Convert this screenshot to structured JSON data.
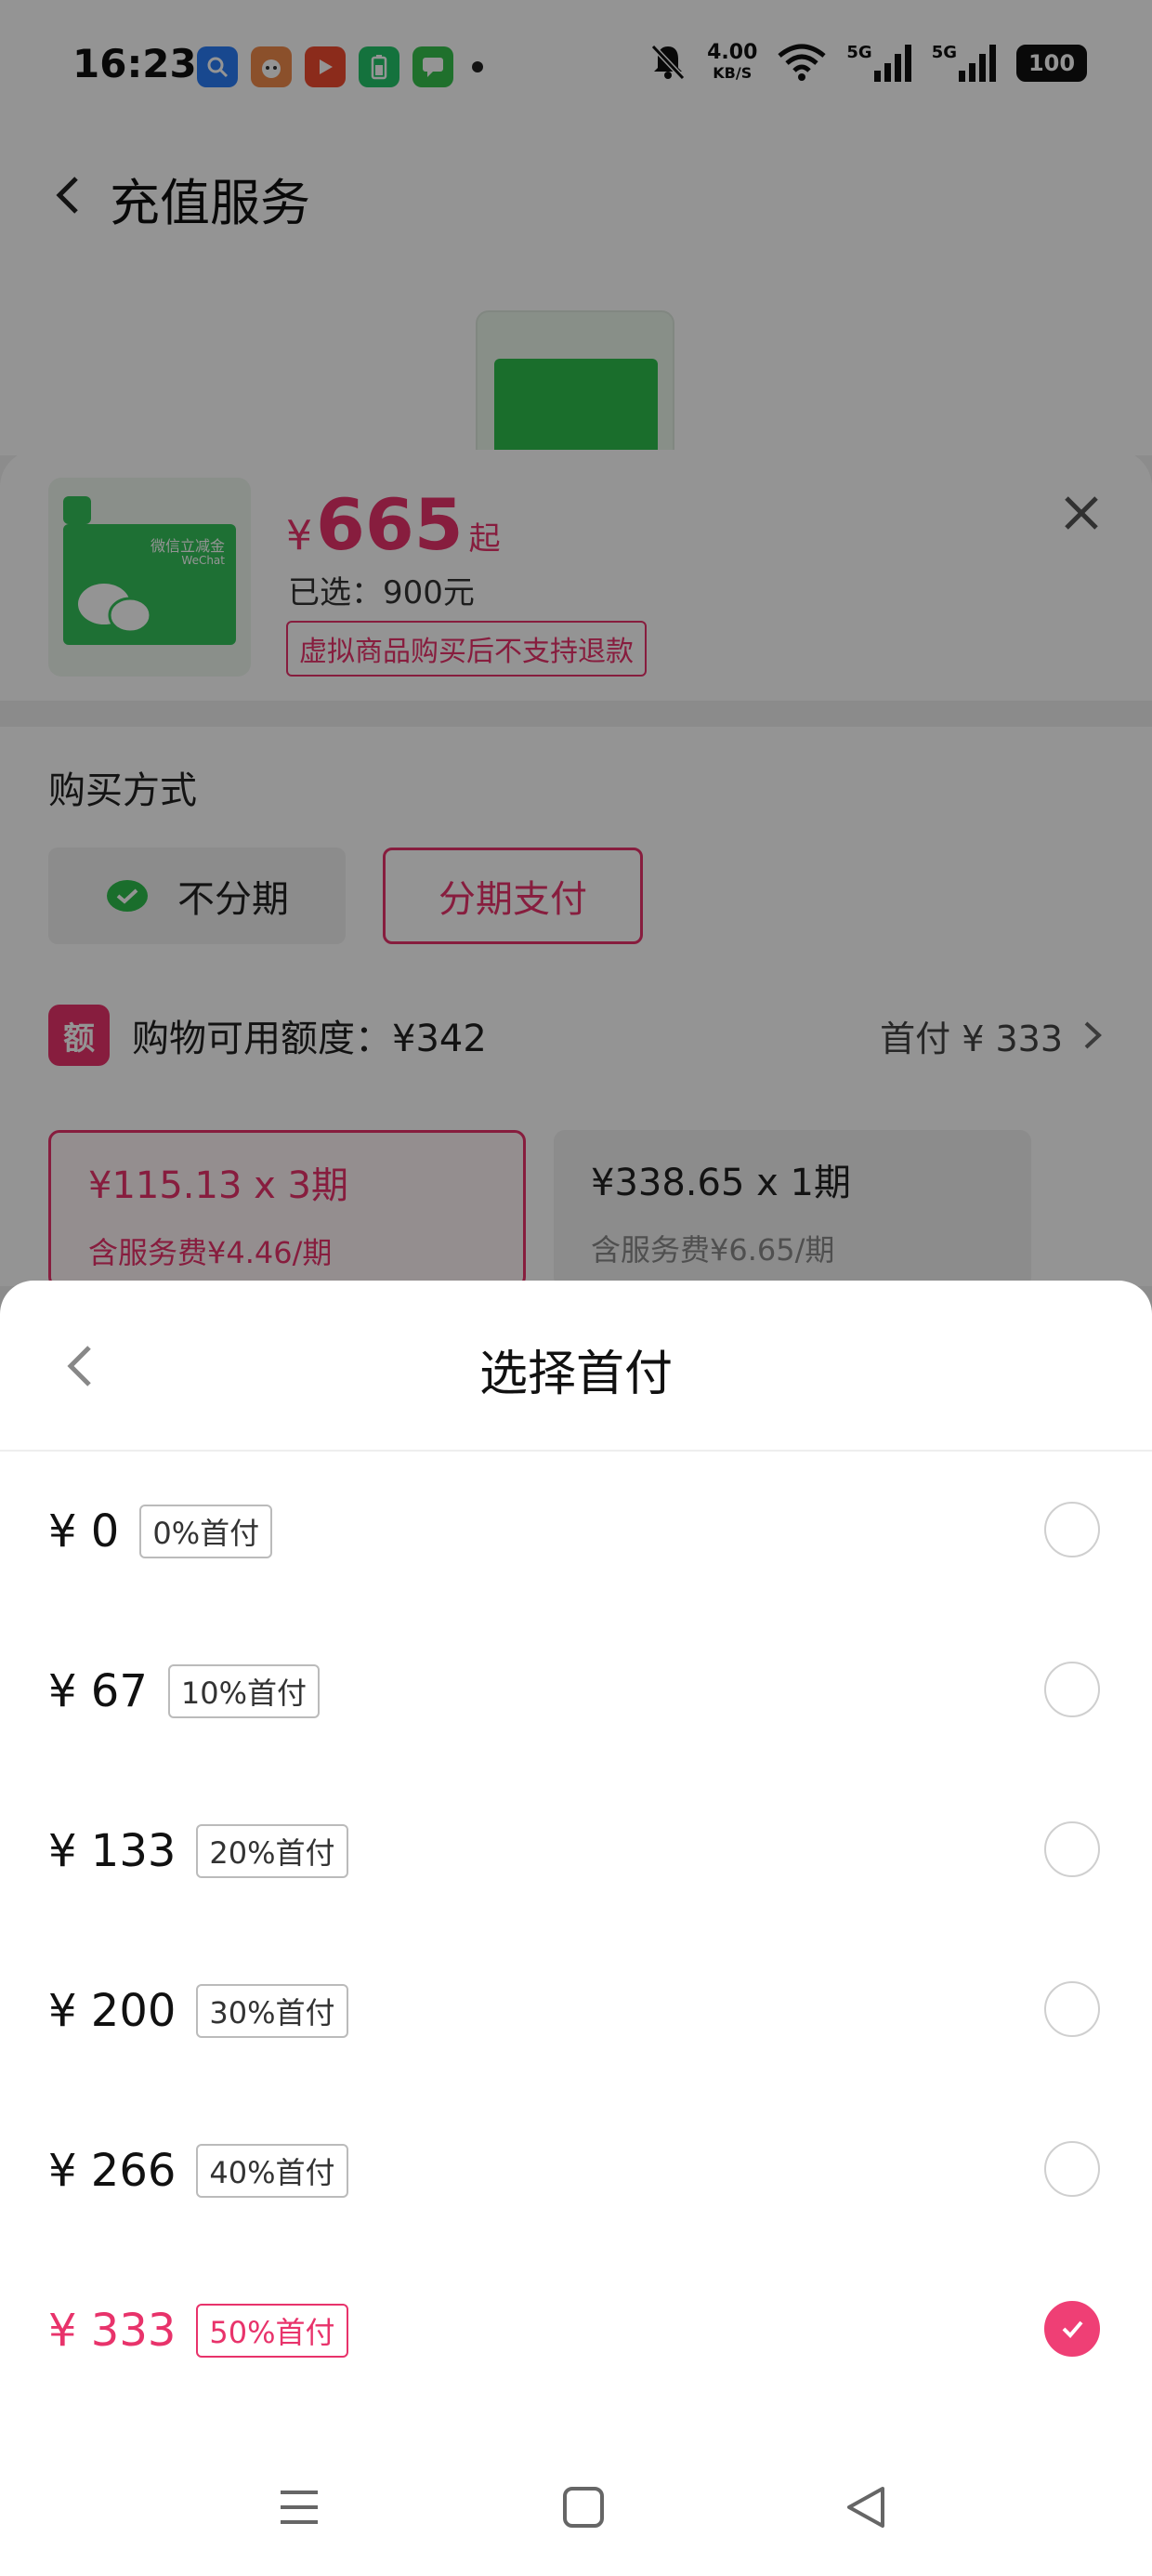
{
  "status_bar": {
    "time": "16:23",
    "net_speed_value": "4.00",
    "net_speed_unit": "KB/S",
    "signal_label_1": "5G",
    "signal_label_2": "5G",
    "battery": "100",
    "app_icons": [
      "search-app-icon",
      "cat-app-icon",
      "video-app-icon",
      "battery-app-icon",
      "message-app-icon"
    ]
  },
  "header": {
    "title": "充值服务"
  },
  "product": {
    "price_symbol": "¥",
    "price": "665",
    "price_suffix": "起",
    "selected": "已选：900元",
    "refund_notice": "虚拟商品购买后不支持退款",
    "thumb_text": "微信立减金",
    "thumb_sub": "WeChat"
  },
  "purchase": {
    "label": "购买方式",
    "option_no_installment": "不分期",
    "option_installment": "分期支付",
    "credit_logo": "额",
    "credit_text": "购物可用额度：¥342",
    "down_payment": "首付 ¥ 333"
  },
  "plans": [
    {
      "main": "¥115.13 x 3期",
      "sub": "含服务费¥4.46/期",
      "selected": true
    },
    {
      "main": "¥338.65 x 1期",
      "sub": "含服务费¥6.65/期",
      "selected": false
    }
  ],
  "modal": {
    "title": "选择首付",
    "options": [
      {
        "amount": "¥ 0",
        "tag": "0%首付",
        "selected": false
      },
      {
        "amount": "¥ 67",
        "tag": "10%首付",
        "selected": false
      },
      {
        "amount": "¥ 133",
        "tag": "20%首付",
        "selected": false
      },
      {
        "amount": "¥ 200",
        "tag": "30%首付",
        "selected": false
      },
      {
        "amount": "¥ 266",
        "tag": "40%首付",
        "selected": false
      },
      {
        "amount": "¥ 333",
        "tag": "50%首付",
        "selected": true
      }
    ]
  },
  "colors": {
    "accent": "#e8336b",
    "radio_active": "#ef3f75",
    "wechat_green": "#2ebd4d"
  }
}
